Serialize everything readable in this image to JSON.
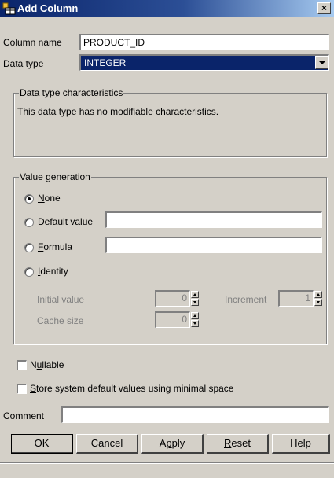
{
  "window": {
    "title": "Add Column",
    "close_label": "×"
  },
  "column_name": {
    "label": "Column name",
    "value": "PRODUCT_ID"
  },
  "data_type": {
    "label": "Data type",
    "value": "INTEGER"
  },
  "characteristics": {
    "legend": "Data type characteristics",
    "message": "This data type has no modifiable characteristics."
  },
  "value_generation": {
    "legend": "Value generation",
    "options": [
      {
        "pre": "",
        "key": "N",
        "post": "one",
        "selected": true
      },
      {
        "pre": "",
        "key": "D",
        "post": "efault value",
        "selected": false
      },
      {
        "pre": "",
        "key": "F",
        "post": "ormula",
        "selected": false
      },
      {
        "pre": "",
        "key": "I",
        "post": "dentity",
        "selected": false
      }
    ],
    "default_value": "",
    "formula_value": "",
    "initial_value_label": "Initial value",
    "initial_value": "0",
    "increment_label": "Increment",
    "increment_value": "1",
    "cache_size_label": "Cache size",
    "cache_size_value": "0"
  },
  "nullable": {
    "pre": "N",
    "key": "u",
    "post": "llable",
    "checked": false
  },
  "store_default": {
    "pre": "",
    "key": "S",
    "post": "tore system default values using minimal space",
    "checked": false
  },
  "comment": {
    "label": "Comment",
    "value": ""
  },
  "buttons": [
    {
      "pre": "",
      "key": "",
      "post": "OK"
    },
    {
      "pre": "",
      "key": "",
      "post": "Cancel"
    },
    {
      "pre": "A",
      "key": "p",
      "post": "ply"
    },
    {
      "pre": "",
      "key": "R",
      "post": "eset"
    },
    {
      "pre": "",
      "key": "",
      "post": "Help"
    }
  ]
}
